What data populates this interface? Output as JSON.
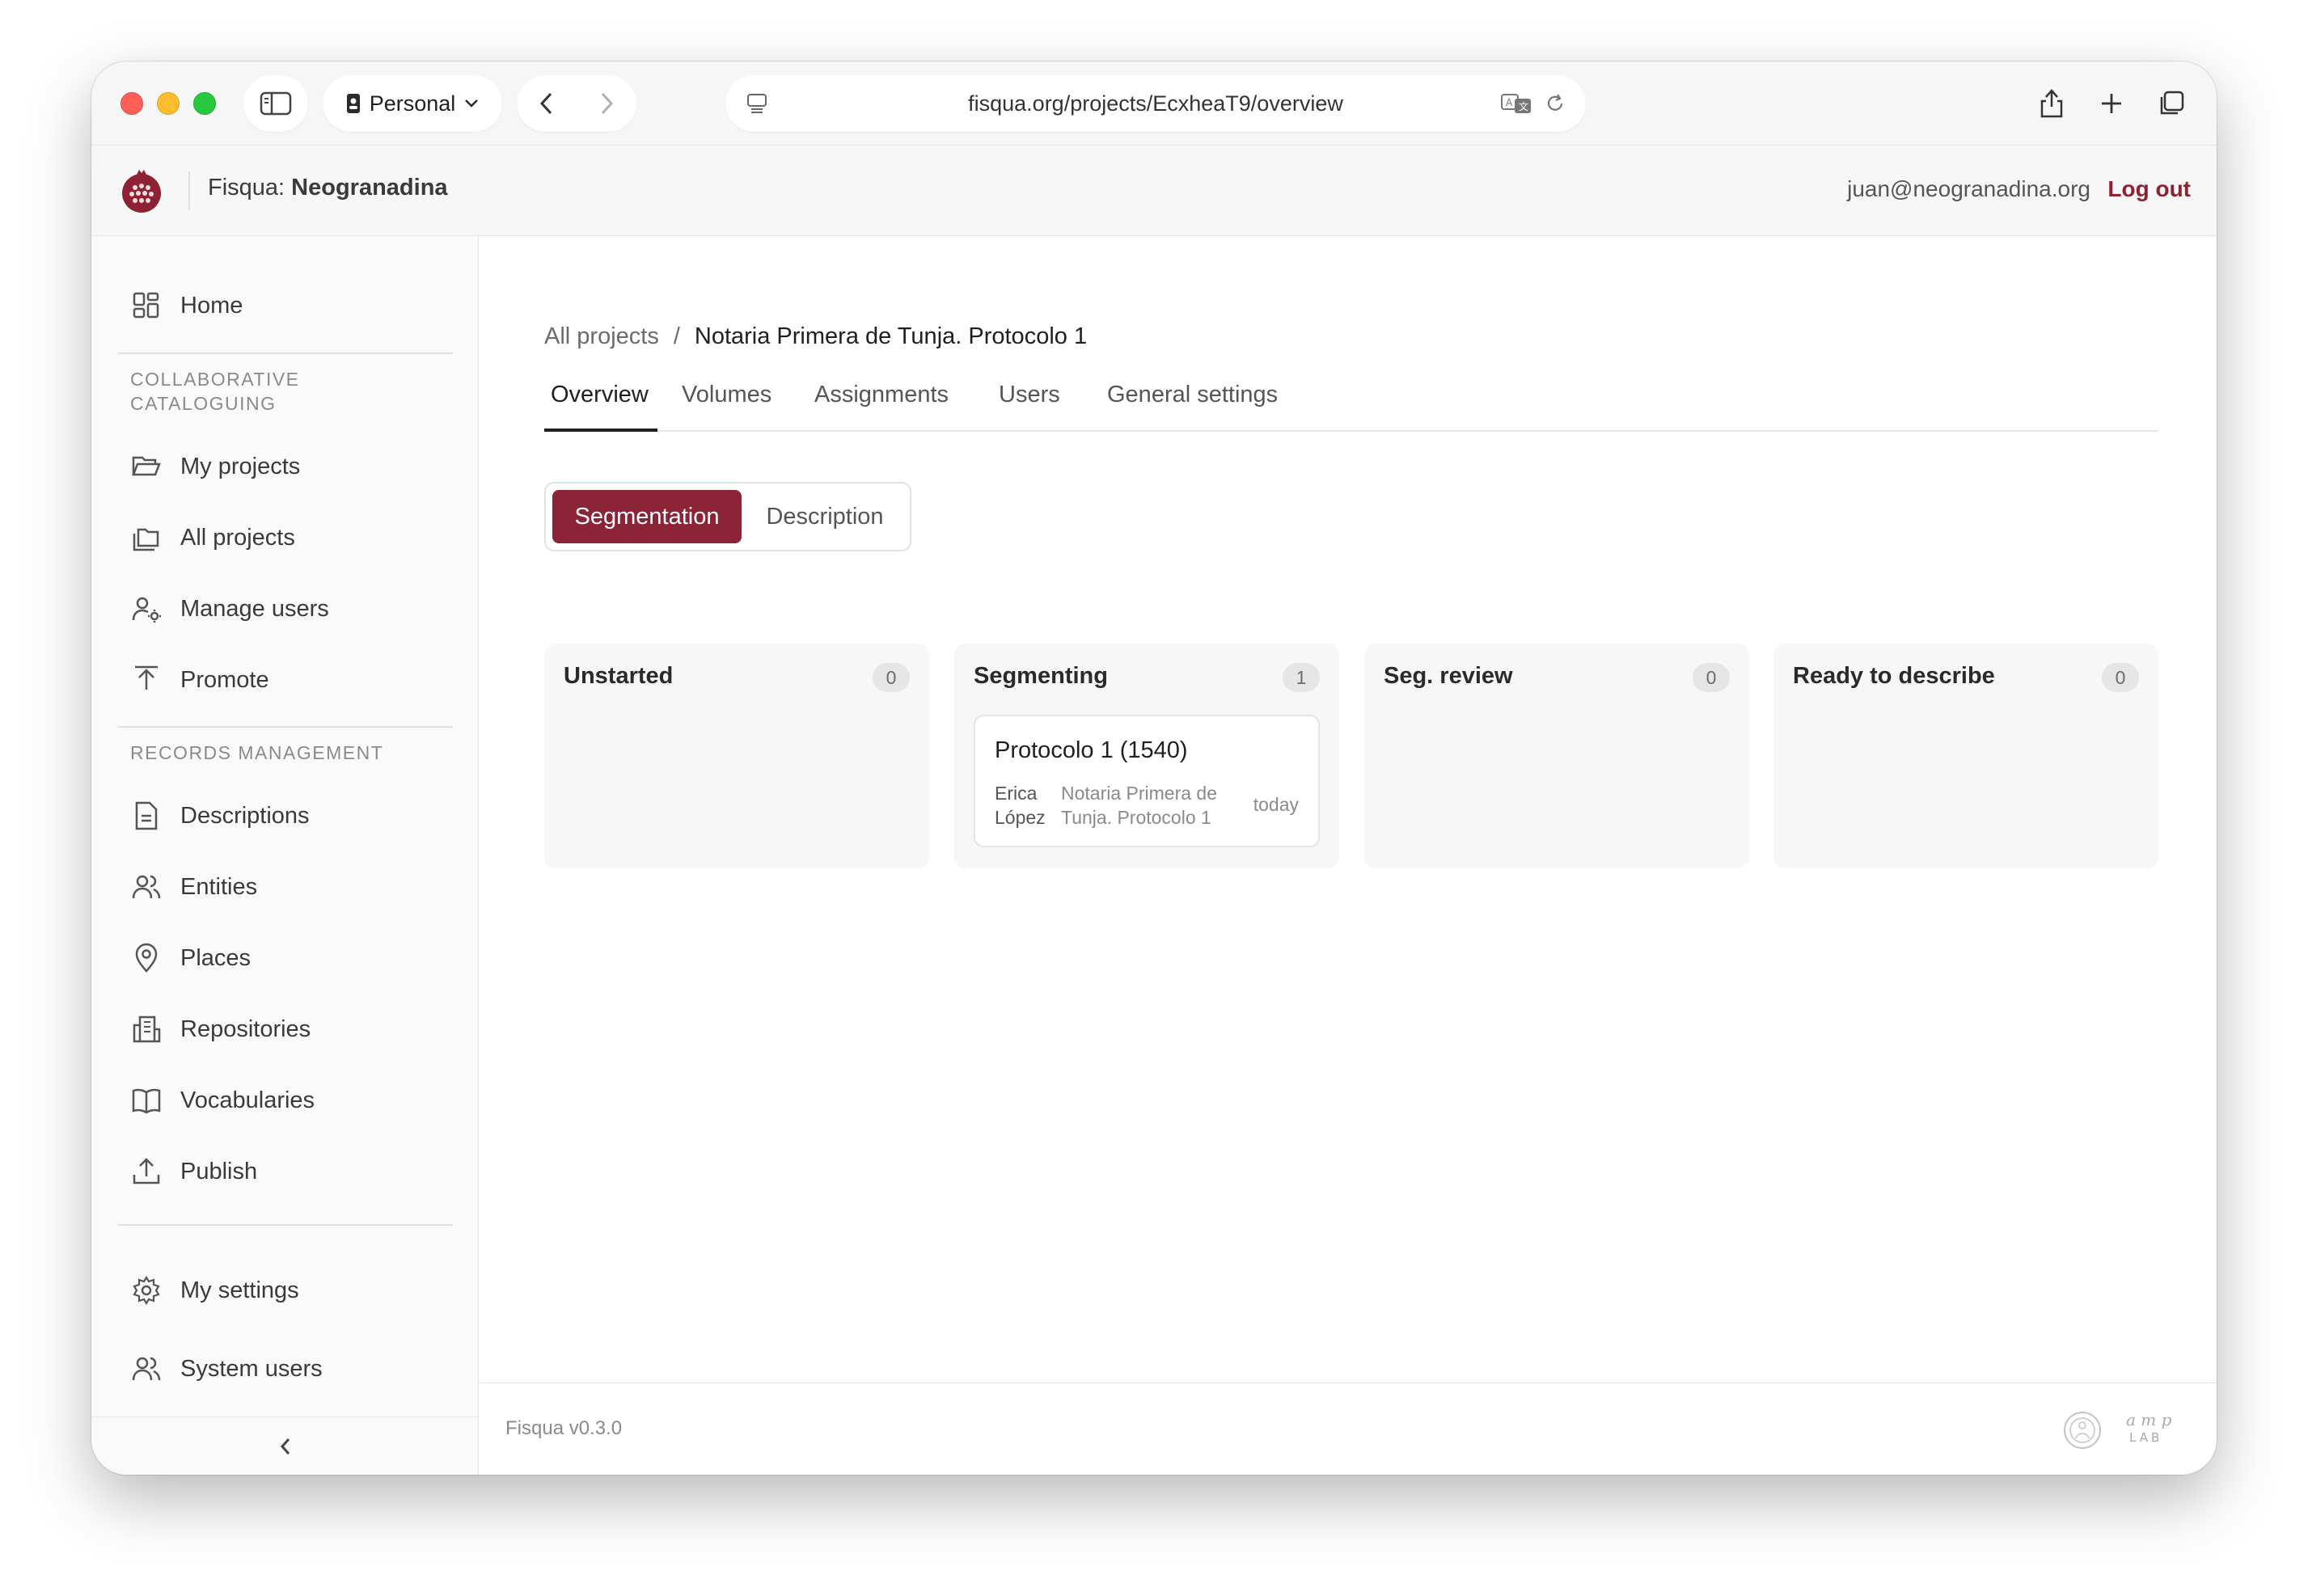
{
  "browser": {
    "profile_label": "Personal",
    "url": "fisqua.org/projects/EcxheaT9/overview"
  },
  "header": {
    "brand_prefix": "Fisqua:",
    "brand_name": "Neogranadina",
    "user_email": "juan@neogranadina.org",
    "logout_label": "Log out",
    "accent_color": "#8c2233"
  },
  "sidebar": {
    "home_label": "Home",
    "section_collab": "COLLABORATIVE CATALOGUING",
    "collab_items": [
      {
        "label": "My projects",
        "icon": "folder-open-icon"
      },
      {
        "label": "All projects",
        "icon": "folders-icon"
      },
      {
        "label": "Manage users",
        "icon": "user-gear-icon"
      },
      {
        "label": "Promote",
        "icon": "upload-arrow-icon"
      }
    ],
    "section_records": "RECORDS MANAGEMENT",
    "records_items": [
      {
        "label": "Descriptions",
        "icon": "document-icon"
      },
      {
        "label": "Entities",
        "icon": "users-icon"
      },
      {
        "label": "Places",
        "icon": "map-pin-icon"
      },
      {
        "label": "Repositories",
        "icon": "building-icon"
      },
      {
        "label": "Vocabularies",
        "icon": "book-open-icon"
      },
      {
        "label": "Publish",
        "icon": "upload-tray-icon"
      }
    ],
    "settings_items": [
      {
        "label": "My settings",
        "icon": "gear-icon"
      },
      {
        "label": "System users",
        "icon": "users-icon"
      }
    ]
  },
  "breadcrumb": {
    "parent": "All projects",
    "separator": "/",
    "current": "Notaria Primera de Tunja. Protocolo 1"
  },
  "tabs": [
    {
      "label": "Overview",
      "active": true
    },
    {
      "label": "Volumes",
      "active": false
    },
    {
      "label": "Assignments",
      "active": false
    },
    {
      "label": "Users",
      "active": false
    },
    {
      "label": "General settings",
      "active": false
    }
  ],
  "segmented": {
    "active": "Segmentation",
    "inactive": "Description",
    "active_color": "#8c2438"
  },
  "columns": [
    {
      "title": "Unstarted",
      "count": "0",
      "cards": []
    },
    {
      "title": "Segmenting",
      "count": "1",
      "cards": [
        {
          "title": "Protocolo 1 (1540)",
          "author": "Erica López",
          "project": "Notaria Primera de Tunja. Protocolo 1",
          "date": "today"
        }
      ]
    },
    {
      "title": "Seg. review",
      "count": "0",
      "cards": []
    },
    {
      "title": "Ready to describe",
      "count": "0",
      "cards": []
    }
  ],
  "footer": {
    "version": "Fisqua v0.3.0"
  }
}
